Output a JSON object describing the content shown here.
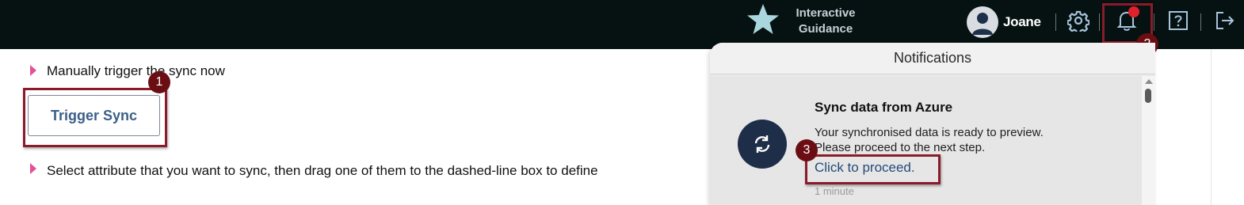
{
  "topbar": {
    "interactive_guidance_line1": "Interactive",
    "interactive_guidance_line2": "Guidance",
    "user_name": "Joane",
    "icons": [
      "star-icon",
      "avatar-icon",
      "gear-icon",
      "bell-icon",
      "help-icon",
      "logout-icon"
    ],
    "has_unread_notifications": true
  },
  "main": {
    "step1_text": "Manually trigger the sync now",
    "trigger_button_label": "Trigger Sync",
    "step2_text": "Select attribute that you want to sync, then drag one of them to the dashed-line box to define"
  },
  "notifications": {
    "title": "Notifications",
    "items": [
      {
        "title": "Sync data from Azure",
        "message_line1": "Your synchronised data is ready to preview.",
        "message_line2": "Please proceed to the next step.",
        "link": "Click to proceed.",
        "time": "1 minute",
        "icon": "sync-icon"
      }
    ]
  },
  "markers": {
    "one": "1",
    "two": "2",
    "three": "3"
  },
  "colors": {
    "topbar_bg": "#061211",
    "accent_highlight": "#8a1b2a",
    "marker_bg": "#6b0e14",
    "bullet": "#e0529a",
    "notif_icon_bg": "#1e2e48",
    "link": "#254a7a"
  }
}
